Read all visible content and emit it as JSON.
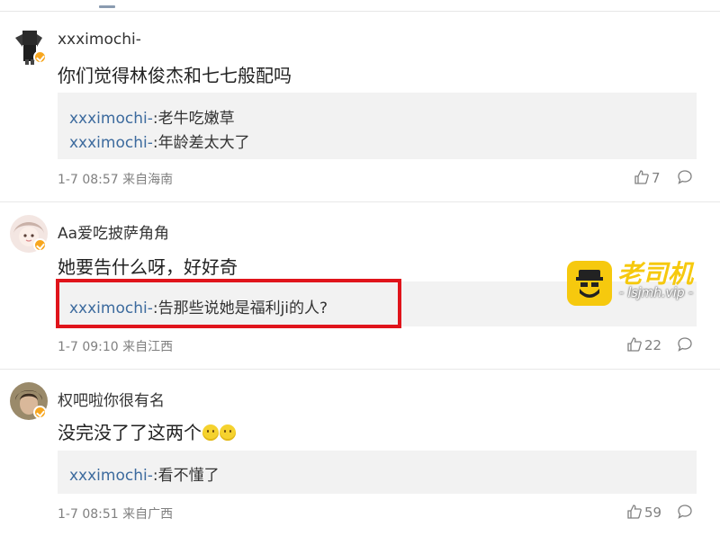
{
  "comments": [
    {
      "username": "xxximochi-",
      "text": "你们觉得林俊杰和七七般配吗",
      "replies": [
        {
          "name": "xxximochi-",
          "text": ":老牛吃嫩草"
        },
        {
          "name": "xxximochi-",
          "text": ":年龄差太大了"
        }
      ],
      "meta": "1-7 08:57 来自海南",
      "likes": "7"
    },
    {
      "username": "Aa爱吃披萨角角",
      "text": "她要告什么呀，好好奇",
      "replies": [
        {
          "name": "xxximochi-",
          "text": ":告那些说她是福利ji的人?"
        }
      ],
      "meta": "1-7 09:10 来自江西",
      "likes": "22"
    },
    {
      "username": "权吧啦你很有名",
      "text": "没完没了了这两个",
      "replies": [
        {
          "name": "xxximochi-",
          "text": ":看不懂了"
        }
      ],
      "meta": "1-7 08:51 来自广西",
      "likes": "59"
    }
  ],
  "watermark": {
    "title": "老司机",
    "url": "- lsjmh.vip -"
  },
  "colors": {
    "reply_name": "#3d6b9e",
    "highlight": "#e0141b",
    "badge": "#f7a61e",
    "watermark": "#f6c90e"
  }
}
